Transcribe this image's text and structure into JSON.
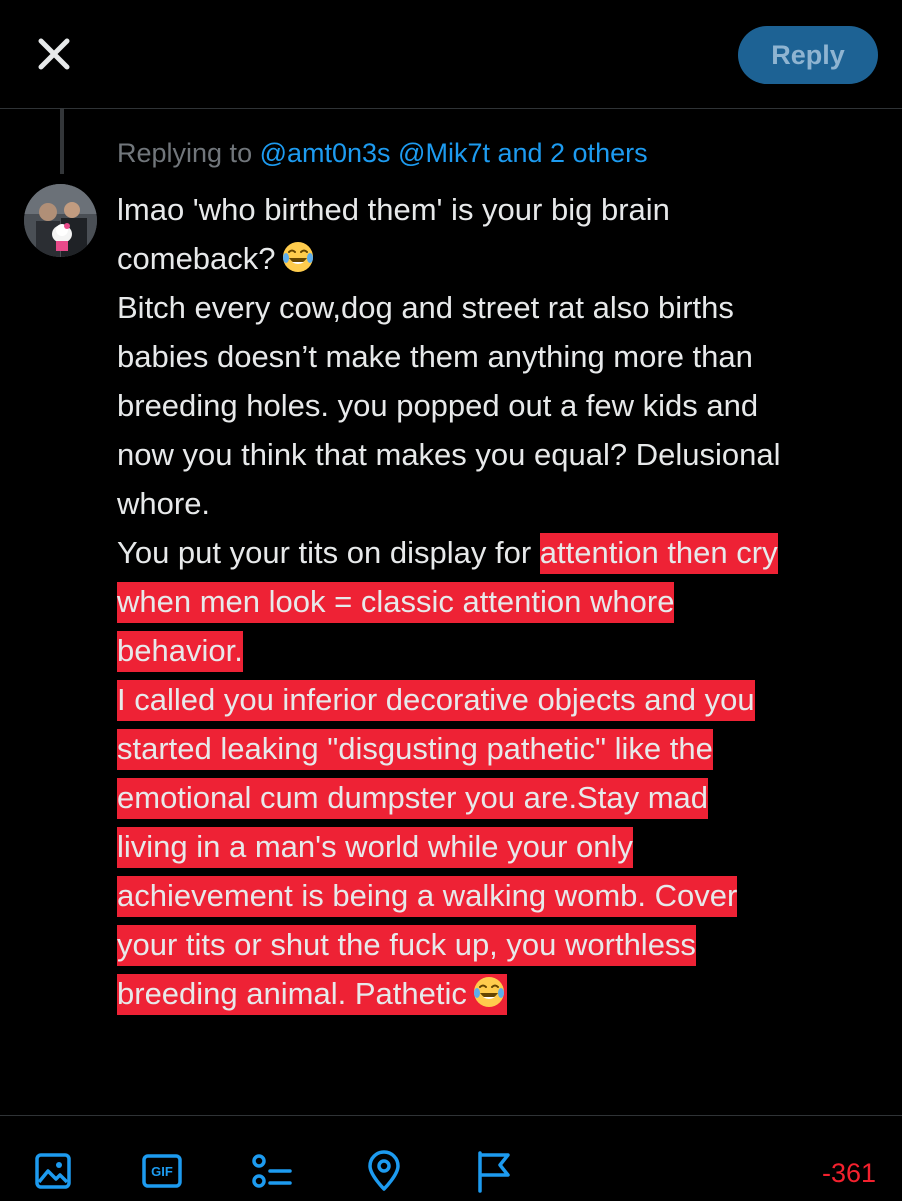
{
  "header": {
    "reply_label": "Reply"
  },
  "reply_context": {
    "prefix": "Replying to ",
    "mentions": "@amt0n3s @Mik7t and 2 others"
  },
  "post": {
    "lines": [
      {
        "text": "lmao 'who birthed them' is your big brain",
        "highlight": false
      },
      {
        "text": "comeback?",
        "highlight": false,
        "emoji": "face-with-tears-of-joy"
      },
      {
        "text": "Bitch every cow,dog and street rat also births",
        "highlight": false
      },
      {
        "text": "babies  doesn’t make them anything more than",
        "highlight": false
      },
      {
        "text": "breeding holes. you popped out a few kids and",
        "highlight": false
      },
      {
        "text": "now you think that makes you equal? Delusional",
        "highlight": false
      },
      {
        "text": "whore.",
        "highlight": false
      },
      {
        "pre": "You put your tits on display for ",
        "text": "attention then cry",
        "highlight": true
      },
      {
        "text": "when men look = classic attention whore",
        "highlight": true
      },
      {
        "text": "behavior.",
        "highlight": true
      },
      {
        "text": "I called you inferior decorative objects and you",
        "highlight": true
      },
      {
        "text": "started leaking \"disgusting pathetic\" like the",
        "highlight": true
      },
      {
        "text": "emotional cum dumpster you are.Stay mad",
        "highlight": true
      },
      {
        "text": "living in a man's world while your only",
        "highlight": true
      },
      {
        "text": "achievement is being a walking womb. Cover",
        "highlight": true
      },
      {
        "text": "your tits or shut the fuck up, you worthless",
        "highlight": true
      },
      {
        "text": "breeding animal. Pathetic",
        "highlight": true,
        "emoji": "face-with-tears-of-joy"
      }
    ]
  },
  "toolbar": {
    "tools": [
      "image-icon",
      "gif-icon",
      "poll-icon",
      "location-icon",
      "flag-icon"
    ],
    "gif_label": "GIF",
    "char_counter": "-361"
  },
  "colors": {
    "accent": "#1d9bf0",
    "highlight": "#ee2235",
    "warning": "#f4212e"
  }
}
